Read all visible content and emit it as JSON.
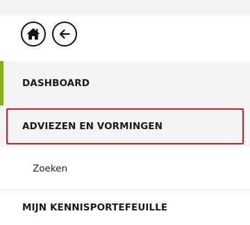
{
  "toolbar": {
    "home_icon": "home-icon",
    "back_icon": "arrow-left-icon"
  },
  "menu": {
    "dashboard_label": "DASHBOARD",
    "adviezen_label": "ADVIEZEN EN VORMINGEN",
    "zoeken_label": "Zoeken",
    "kennis_label": "MIJN KENNISPORTEFEUILLE"
  },
  "colors": {
    "active_indicator": "#86b11e",
    "highlight_border": "#c81e2a",
    "menu_background": "#f4f4f4"
  }
}
